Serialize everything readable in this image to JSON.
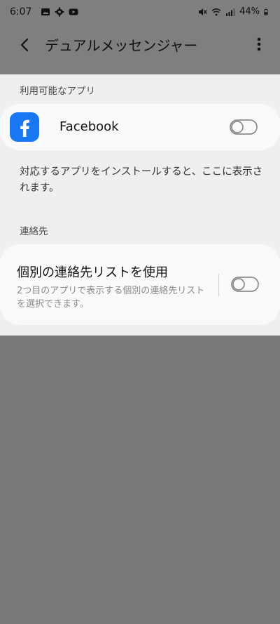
{
  "status_bar": {
    "time": "6:07",
    "battery": "44%",
    "left_icons": [
      "image-icon",
      "settings-icon",
      "youtube-icon"
    ],
    "right_icons": [
      "mute-icon",
      "wifi-icon",
      "signal-icon",
      "battery-icon"
    ]
  },
  "app_bar": {
    "title": "デュアルメッセンジャー",
    "back_icon": "back-arrow-icon",
    "more_icon": "more-vert-icon"
  },
  "available_apps": {
    "header": "利用可能なアプリ",
    "apps": [
      {
        "name": "Facebook",
        "icon": "facebook-icon",
        "enabled": false
      }
    ],
    "info_text": "対応するアプリをインストールすると、ここに表示されます。"
  },
  "contacts": {
    "header": "連絡先",
    "option": {
      "title": "個別の連絡先リストを使用",
      "description": "2つ目のアプリで表示する個別の連絡先リストを選択できます。",
      "enabled": false
    }
  },
  "colors": {
    "scrim": "#7a7a7a",
    "content_bg": "#efefef",
    "card_bg": "#f9f9f9",
    "facebook_blue": "#1877f2"
  }
}
